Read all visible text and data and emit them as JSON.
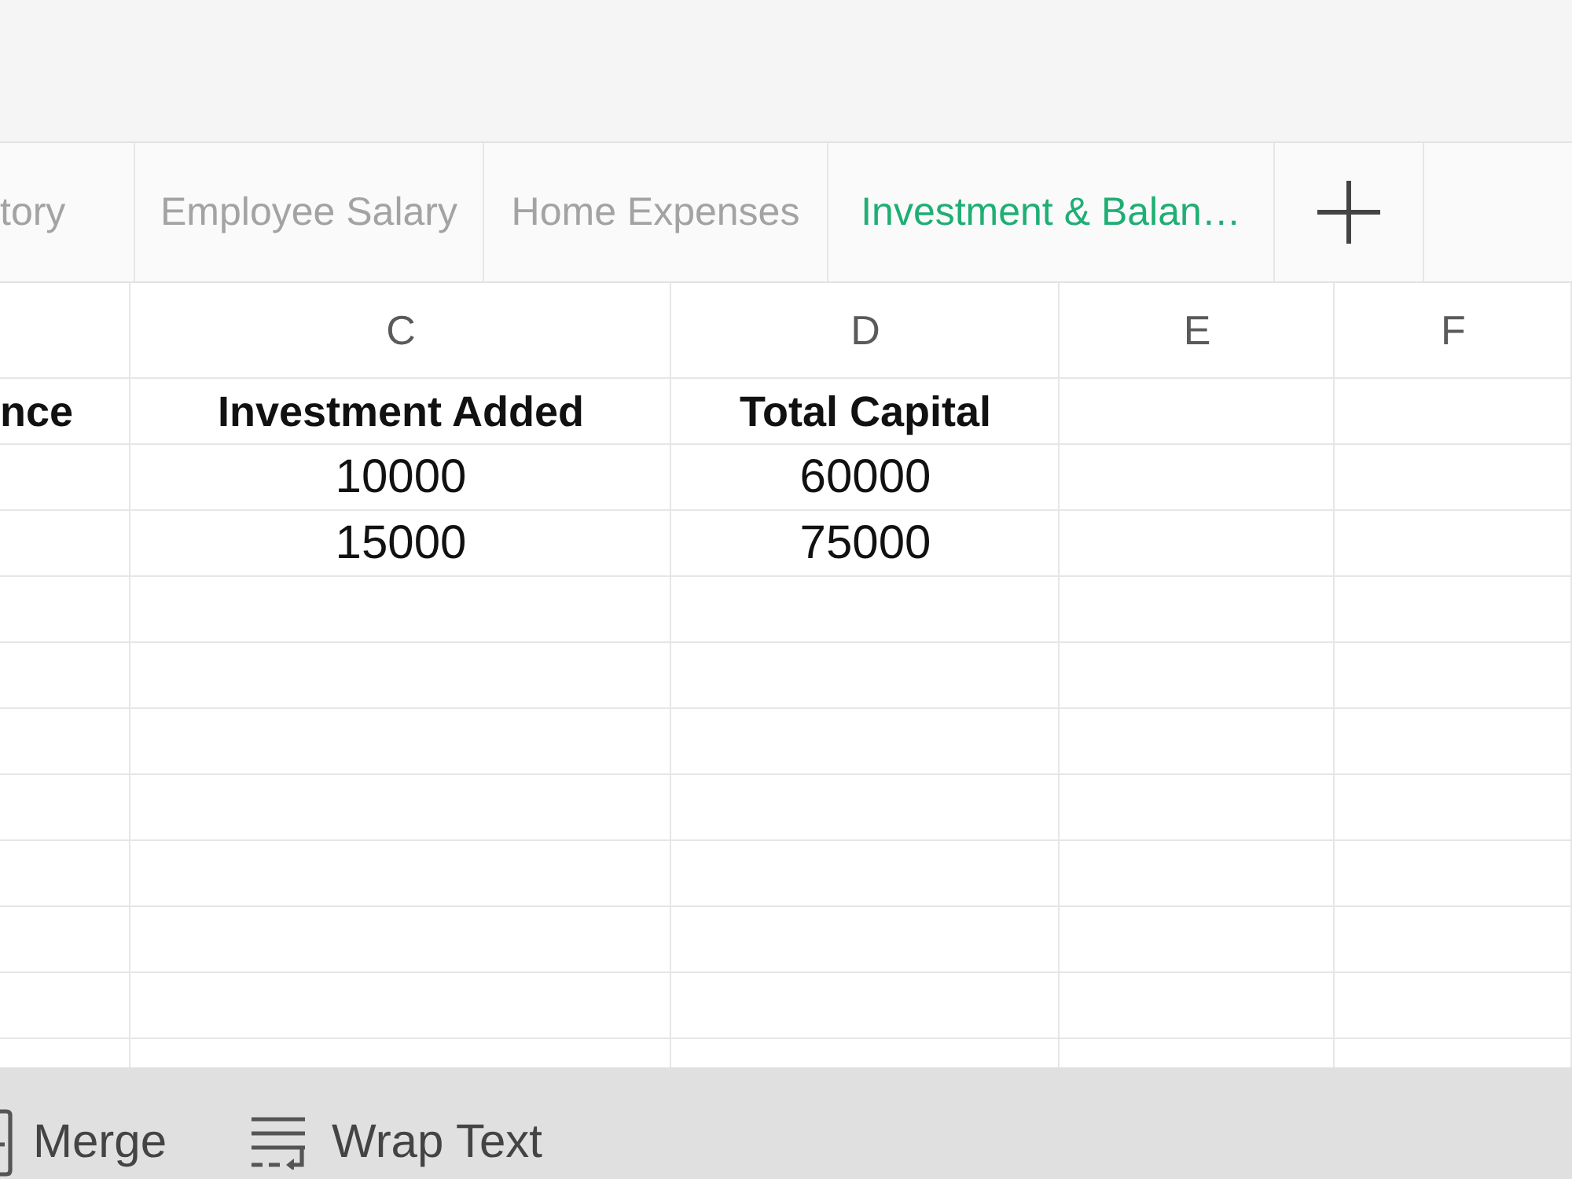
{
  "sheet_tabs": [
    {
      "label": "tory",
      "selected": false
    },
    {
      "label": "Employee Salary",
      "selected": false
    },
    {
      "label": "Home Expenses",
      "selected": false
    },
    {
      "label": "Investment & Balan…",
      "selected": true
    }
  ],
  "columns": [
    {
      "heading": "nce"
    },
    {
      "letter": "C",
      "heading": "Investment Added",
      "cells": [
        "10000",
        "15000"
      ]
    },
    {
      "letter": "D",
      "heading": "Total Capital",
      "cells": [
        "60000",
        "75000"
      ]
    },
    {
      "letter": "E"
    },
    {
      "letter": "F"
    }
  ],
  "toolbar": [
    {
      "kind": "merge",
      "label": "Merge"
    },
    {
      "kind": "wrap",
      "label": "Wrap Text"
    }
  ]
}
